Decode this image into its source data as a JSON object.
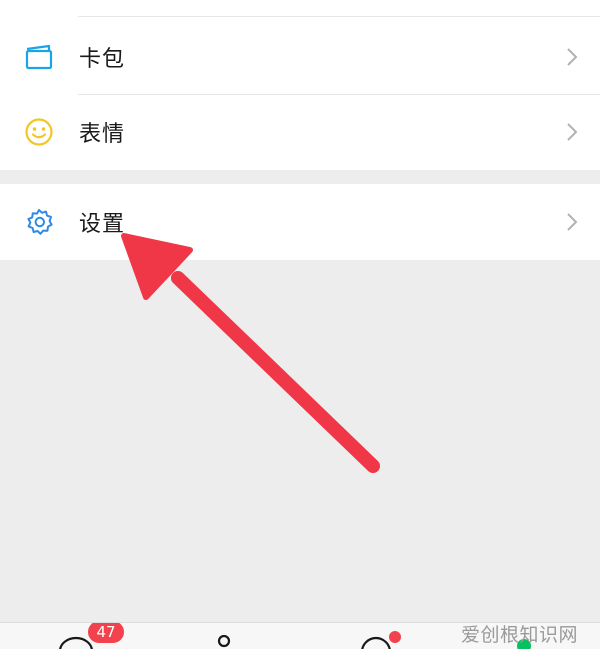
{
  "menu": {
    "items": [
      {
        "label": "卡包",
        "icon": "card-wallet-icon"
      },
      {
        "label": "表情",
        "icon": "smiley-icon"
      },
      {
        "label": "设置",
        "icon": "gear-icon"
      }
    ]
  },
  "bottom_bar": {
    "chats_badge": "47"
  },
  "watermark": "爱创根知识网",
  "colors": {
    "card_icon": "#1aa3e8",
    "sticker_icon": "#f3c624",
    "settings_icon": "#2f8ae5",
    "badge": "#f2424d",
    "arrow": "#f03748",
    "online_dot": "#07c160"
  }
}
